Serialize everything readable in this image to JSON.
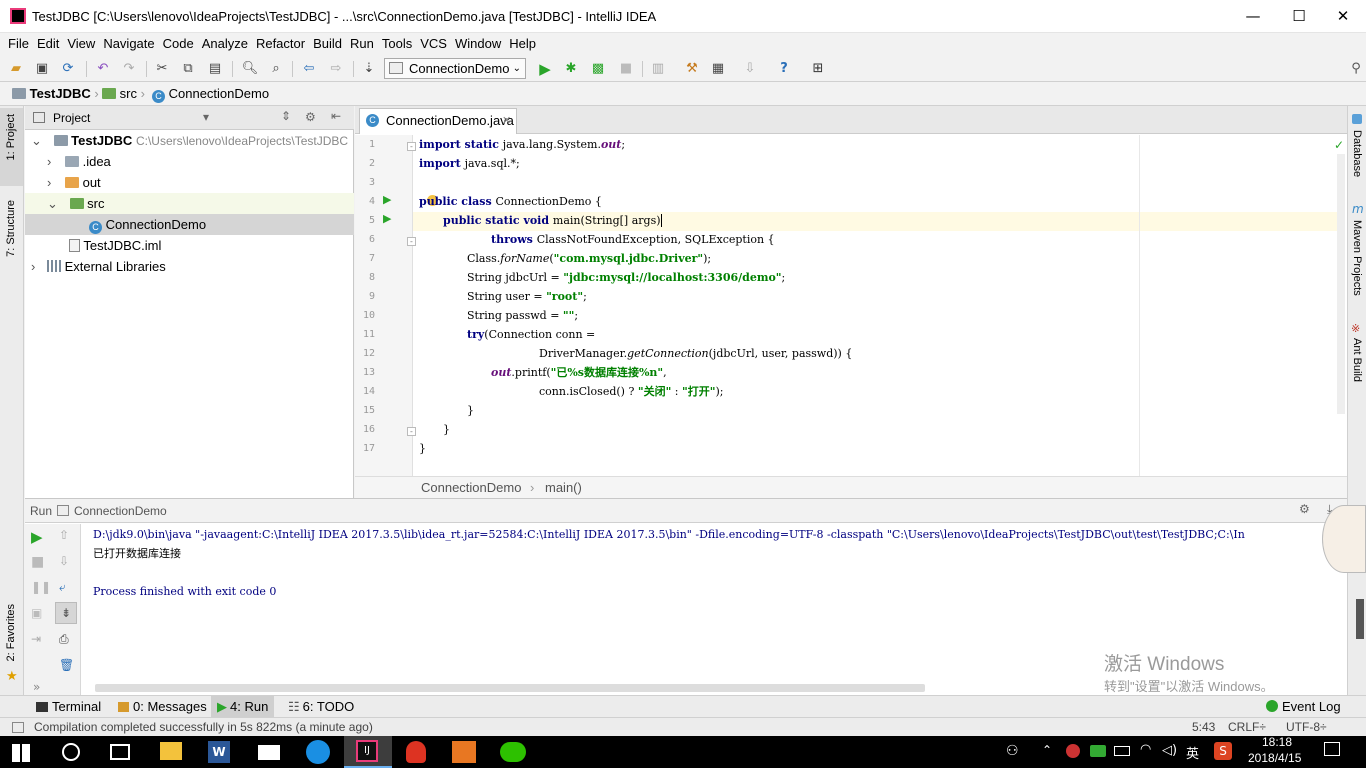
{
  "window": {
    "title": "TestJDBC [C:\\Users\\lenovo\\IdeaProjects\\TestJDBC] - ...\\src\\ConnectionDemo.java [TestJDBC] - IntelliJ IDEA",
    "minimize": "—",
    "maximize": "☐",
    "close": "✕"
  },
  "menu": [
    "File",
    "Edit",
    "View",
    "Navigate",
    "Code",
    "Analyze",
    "Refactor",
    "Build",
    "Run",
    "Tools",
    "VCS",
    "Window",
    "Help"
  ],
  "toolbar": {
    "run_config": "ConnectionDemo"
  },
  "breadcrumb": [
    "TestJDBC",
    "src",
    "ConnectionDemo"
  ],
  "left_strip": {
    "project_tab": "1: Project",
    "structure_tab": "7: Structure",
    "favorites_tab": "2: Favorites"
  },
  "right_strip": [
    "Database",
    "Maven Projects",
    "Ant Build"
  ],
  "project": {
    "header": "Project",
    "tree": [
      {
        "label": "TestJDBC",
        "path": "C:\\Users\\lenovo\\IdeaProjects\\TestJDBC"
      },
      {
        "label": ".idea"
      },
      {
        "label": "out"
      },
      {
        "label": "src"
      },
      {
        "label": "ConnectionDemo"
      },
      {
        "label": "TestJDBC.iml"
      },
      {
        "label": "External Libraries"
      }
    ]
  },
  "editor": {
    "tab": "ConnectionDemo.java",
    "line_numbers": [
      "1",
      "2",
      "3",
      "4",
      "5",
      "6",
      "7",
      "8",
      "9",
      "10",
      "11",
      "12",
      "13",
      "14",
      "15",
      "16",
      "17"
    ],
    "code": {
      "l1": [
        "import static ",
        "java.lang.System.",
        "out",
        ";"
      ],
      "l2": [
        "import ",
        "java.sql.*;"
      ],
      "l4": [
        "public class ",
        "ConnectionDemo {"
      ],
      "l5": [
        "public static void ",
        "main(String[] args)"
      ],
      "l6": [
        "throws ",
        "ClassNotFoundException, SQLException {"
      ],
      "l7": [
        "Class.",
        "forName",
        "(",
        "\"com.mysql.jdbc.Driver\"",
        ");"
      ],
      "l8": [
        "String jdbcUrl = ",
        "\"jdbc:mysql://localhost:3306/demo\"",
        ";"
      ],
      "l9": [
        "String user = ",
        "\"root\"",
        ";"
      ],
      "l10": [
        "String passwd = ",
        "\"\"",
        ";"
      ],
      "l11": [
        "try",
        "(Connection conn ="
      ],
      "l12": [
        "DriverManager.",
        "getConnection",
        "(jdbcUrl, user, passwd)) {"
      ],
      "l13": [
        "out",
        ".printf(",
        "\"已%s数据库连接%n\"",
        ","
      ],
      "l14": [
        "conn.isClosed() ? ",
        "\"关闭\"",
        " : ",
        "\"打开\"",
        ");"
      ],
      "l15": [
        "}"
      ],
      "l16": [
        "}"
      ],
      "l17": [
        "}"
      ]
    },
    "bottom_breadcrumb": [
      "ConnectionDemo",
      "main()"
    ]
  },
  "run": {
    "header_label": "Run",
    "config": "ConnectionDemo",
    "console": [
      "D:\\jdk9.0\\bin\\java \"-javaagent:C:\\IntelliJ IDEA 2017.3.5\\lib\\idea_rt.jar=52584:C:\\IntelliJ IDEA 2017.3.5\\bin\" -Dfile.encoding=UTF-8 -classpath \"C:\\Users\\lenovo\\IdeaProjects\\TestJDBC\\out\\test\\TestJDBC;C:\\In",
      "已打开数据库连接",
      "",
      "Process finished with exit code 0"
    ]
  },
  "tool_windows": {
    "terminal": "Terminal",
    "messages": "0: Messages",
    "run": "4: Run",
    "todo": "6: TODO",
    "event_log": "Event Log"
  },
  "status": {
    "message": "Compilation completed successfully in 5s 822ms (a minute ago)",
    "position": "5:43",
    "line_sep": "CRLF÷",
    "encoding": "UTF-8÷"
  },
  "watermark": {
    "line1": "激活 Windows",
    "line2": "转到\"设置\"以激活 Windows。"
  },
  "taskbar": {
    "ime": "英",
    "time": "18:18",
    "date": "2018/4/15"
  },
  "colors": {
    "keyword": "#000080",
    "string": "#008000",
    "field": "#660e7a",
    "run_green": "#2aa52a",
    "current_line": "#fffae3"
  }
}
